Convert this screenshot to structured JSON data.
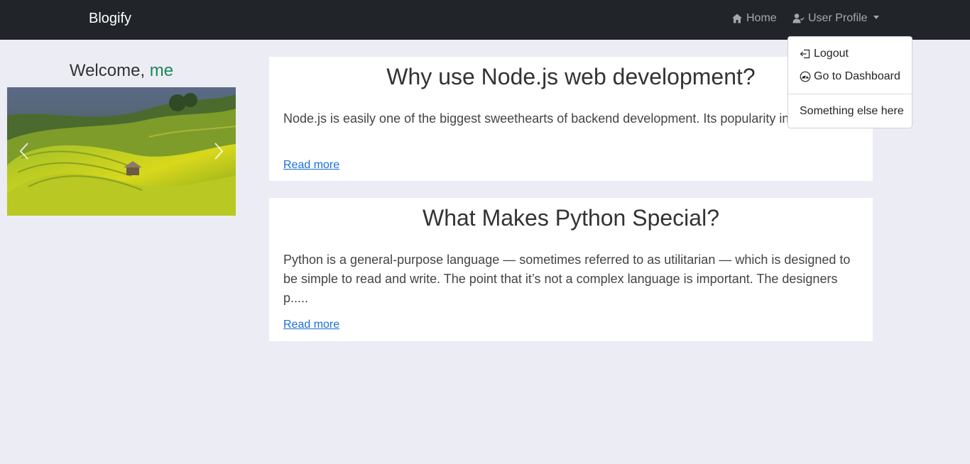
{
  "navbar": {
    "brand": "Blogify",
    "home_label": "Home",
    "profile_label": "User Profile",
    "background": "#212529"
  },
  "dropdown": {
    "items": [
      {
        "label": "Logout",
        "icon": "logout-icon"
      },
      {
        "label": "Go to Dashboard",
        "icon": "dashboard-icon"
      },
      {
        "label": "Something else here"
      }
    ]
  },
  "sidebar": {
    "welcome_prefix": "Welcome,",
    "username": "me",
    "username_color": "#198754",
    "carousel_image": "rice-terraces-landscape"
  },
  "posts": [
    {
      "title": "Why use Node.js web development?",
      "excerpt": "Node.js is easily one of the biggest sweethearts of backend development. Its popularity in the world is constantly growing, especially in the USA with its start-up kingdom, Silicon Valley. It’s no.....",
      "link_label": "Read more"
    },
    {
      "title": "What Makes Python Special?",
      "excerpt": "Python is a general-purpose language — sometimes referred to as utilitarian — which is designed to be simple to read and write. The point that it’s not a complex language is important. The designers p.....",
      "link_label": "Read more"
    }
  ],
  "colors": {
    "page_background": "#ececf5",
    "link": "#1a6ed8"
  }
}
